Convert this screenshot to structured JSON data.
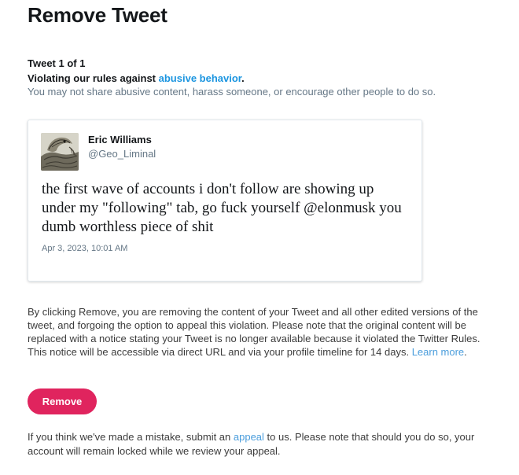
{
  "page": {
    "title": "Remove Tweet",
    "counter": "Tweet 1 of 1"
  },
  "violation": {
    "prefix": "Violating our rules against ",
    "link": "abusive behavior",
    "suffix": ".",
    "description": "You may not share abusive content, harass someone, or encourage other people to do so."
  },
  "tweet": {
    "author_name": "Eric Williams",
    "author_handle": "@Geo_Liminal",
    "avatar_icon": "reptile-avatar-icon",
    "text": "the first wave of accounts i don't follow are showing up under my \"following\" tab, go fuck yourself @elonmusk you dumb worthless piece of shit",
    "timestamp": "Apr 3, 2023, 10:01 AM"
  },
  "disclaimer": {
    "body": "By clicking Remove, you are removing the content of your Tweet and all other edited versions of the tweet, and forgoing the option to appeal this violation. Please note that the original content will be replaced with a notice stating your Tweet is no longer available because it violated the Twitter Rules. This notice will be accessible via direct URL and via your profile timeline for 14 days. ",
    "learn_more": "Learn more",
    "learn_more_suffix": "."
  },
  "actions": {
    "remove_label": "Remove"
  },
  "appeal": {
    "prefix": "If you think we've made a mistake, submit an ",
    "link": "appeal",
    "suffix": " to us. Please note that should you do so, your account will remain locked while we review your appeal."
  },
  "colors": {
    "accent_link": "#1b95e0",
    "remove_button": "#e0245e",
    "muted_text": "#657786"
  }
}
